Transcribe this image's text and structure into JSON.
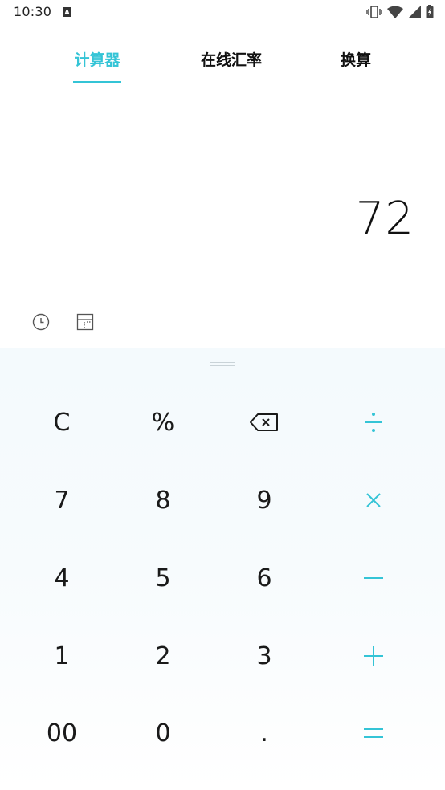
{
  "status_bar": {
    "time": "10:30",
    "notification_icon": "A"
  },
  "tabs": [
    {
      "label": "计算器",
      "active": true
    },
    {
      "label": "在线汇率",
      "active": false
    },
    {
      "label": "换算",
      "active": false
    }
  ],
  "display": {
    "value": "72"
  },
  "tools": {
    "history_icon": "clock-icon",
    "layout_icon": "layout-icon"
  },
  "keypad": {
    "row1": [
      "C",
      "%",
      "⌫",
      "÷"
    ],
    "row2": [
      "7",
      "8",
      "9",
      "×"
    ],
    "row3": [
      "4",
      "5",
      "6",
      "−"
    ],
    "row4": [
      "1",
      "2",
      "3",
      "+"
    ],
    "row5": [
      "00",
      "0",
      ".",
      "="
    ]
  },
  "colors": {
    "accent": "#34c4d6",
    "text": "#1a1a1a",
    "keypad_bg": "#f4fafd"
  }
}
